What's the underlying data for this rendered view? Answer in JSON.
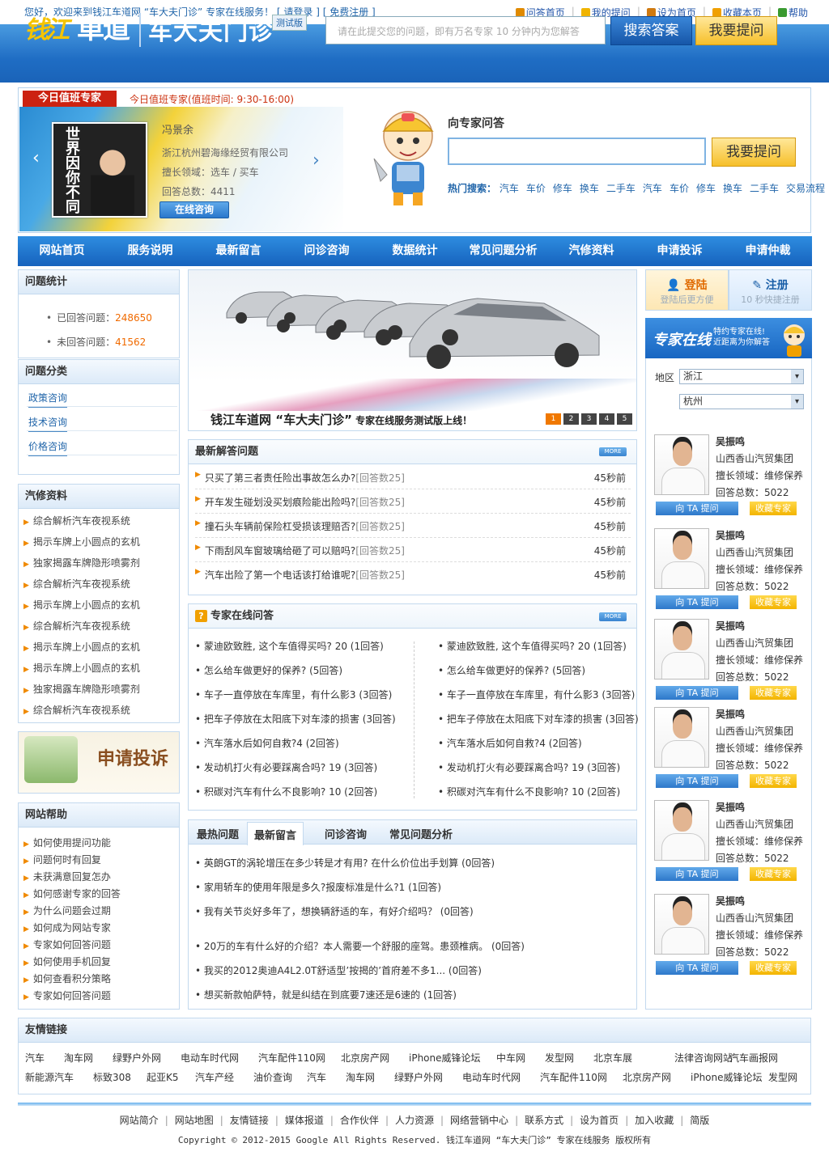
{
  "topbar": {
    "welcome": "您好，欢迎来到钱江车道网 “车大夫门诊” 专家在线服务！",
    "login": "[ 请登录 ]",
    "register": "[ 免费注册 ]",
    "links": [
      {
        "label": "问答首页",
        "icon": "home-icon",
        "color": "#e08a00"
      },
      {
        "label": "我的提问",
        "icon": "bulb-icon",
        "color": "#f0b400"
      },
      {
        "label": "设为首页",
        "icon": "pencil-icon",
        "color": "#d07a10"
      },
      {
        "label": "收藏本页",
        "icon": "star-icon",
        "color": "#f0a000"
      },
      {
        "label": "帮助",
        "icon": "help-icon",
        "color": "#3a9a30"
      }
    ]
  },
  "header": {
    "logo_qj": "钱江",
    "logo_cd": "車道",
    "title": "车大夫门诊",
    "badge": "测试版",
    "search_placeholder": "请在此提交您的问题，即有万名专家 10 分钟内为您解答",
    "search_button": "搜索答案",
    "ask_button": "我要提问"
  },
  "duty": {
    "badge": "今日值班专家",
    "title": "今日值班专家(值班时间: 9:30-16:00)",
    "book_text": "世界因你不同",
    "name": "冯景余",
    "company": "浙江杭州碧海缘经贸有限公司",
    "field": "擅长领域：选车 / 买车",
    "count": "回答总数：4411",
    "consult": "在线咨询"
  },
  "ask": {
    "title": "向专家问答",
    "button": "我要提问",
    "hot_label": "热门搜索：",
    "hot": [
      "汽车",
      "车价",
      "修车",
      "换车",
      "二手车",
      "汽车",
      "车价",
      "修车",
      "换车",
      "二手车",
      "交易流程"
    ]
  },
  "nav": [
    "网站首页",
    "服务说明",
    "最新留言",
    "问诊咨询",
    "数据统计",
    "常见问题分析",
    "汽修资料",
    "申请投诉",
    "申请仲裁"
  ],
  "stats": {
    "title": "问题统计",
    "answered_label": "已回答问题：",
    "answered": "248650",
    "unanswered_label": "未回答问题：",
    "unanswered": "41562"
  },
  "categories": {
    "title": "问题分类",
    "items": [
      "政策咨询",
      "技术咨询",
      "价格咨询"
    ]
  },
  "autos": {
    "title": "汽修资料",
    "items": [
      "综合解析汽车夜视系统",
      "揭示车牌上小圆点的玄机",
      "独家揭露车牌隐形喷雾剂",
      "综合解析汽车夜视系统",
      "揭示车牌上小圆点的玄机",
      "综合解析汽车夜视系统",
      "揭示车牌上小圆点的玄机",
      "揭示车牌上小圆点的玄机",
      "独家揭露车牌隐形喷雾剂",
      "综合解析汽车夜视系统"
    ]
  },
  "complain": {
    "label": "申请投诉"
  },
  "help": {
    "title": "网站帮助",
    "items": [
      "如何使用提问功能",
      "问题何时有回复",
      "未获满意回复怎办",
      "如何感谢专家的回答",
      "为什么问题会过期",
      "如何成为网站专家",
      "专家如何回答问题",
      "如何使用手机回复",
      "如何查看积分策略",
      "专家如何回答问题"
    ]
  },
  "banner": {
    "text": "钱江车道网 “车大夫门诊”",
    "sub": " 专家在线服务测试版上线！",
    "dots": [
      "1",
      "2",
      "3",
      "4",
      "5"
    ]
  },
  "latest": {
    "title": "最新解答问题",
    "more": "MORE",
    "items": [
      {
        "q": "只买了第三者责任险出事故怎么办?",
        "c": "[回答数25]",
        "t": "45秒前"
      },
      {
        "q": "开车发生碰划没买划痕险能出险吗?",
        "c": "[回答数25]",
        "t": "45秒前"
      },
      {
        "q": "撞石头车辆前保险杠受损该理赔否?",
        "c": "[回答数25]",
        "t": "45秒前"
      },
      {
        "q": "下雨刮风车窗玻璃给砸了可以赔吗?",
        "c": "[回答数25]",
        "t": "45秒前"
      },
      {
        "q": "汽车出险了第一个电话该打给谁呢?",
        "c": "[回答数25]",
        "t": "45秒前"
      }
    ]
  },
  "online": {
    "title": "专家在线问答",
    "more": "MORE",
    "left": [
      "蒙迪欧致胜, 这个车值得买吗? 20 (1回答)",
      "怎么给车做更好的保养? (5回答)",
      "车子一直停放在车库里，有什么影3 (3回答)",
      "把车子停放在太阳底下对车漆的损害 (3回答)",
      "汽车落水后如何自救?4 (2回答)",
      "发动机打火有必要踩离合吗? 19 (3回答)",
      "积碳对汽车有什么不良影响? 10 (2回答)"
    ],
    "right": [
      "蒙迪欧致胜, 这个车值得买吗? 20 (1回答)",
      "怎么给车做更好的保养? (5回答)",
      "车子一直停放在车库里，有什么影3 (3回答)",
      "把车子停放在太阳底下对车漆的损害 (3回答)",
      "汽车落水后如何自救?4 (2回答)",
      "发动机打火有必要踩离合吗? 19 (3回答)",
      "积碳对汽车有什么不良影响? 10 (2回答)"
    ]
  },
  "tabs": {
    "labels": [
      "最热问题",
      "最新留言",
      "问诊咨询",
      "常见问题分析"
    ],
    "items": [
      "英朗GT的涡轮增压在多少转是才有用? 在什么价位出手划算 (0回答)",
      "家用轿车的使用年限是多久?报废标准是什么?1 (1回答)",
      "我有关节炎好多年了，想换辆舒适的车，有好介绍吗？ (0回答)",
      "20万的车有什么好的介绍？本人需要一个舒服的座驾。患颈椎病。 (0回答)",
      "我买的2012奥迪A4L2.0T舒适型’按揭的’首府差不多1... (0回答)",
      "想买新款帕萨特，就是纠结在到底要7速还是6速的 (1回答)"
    ]
  },
  "login": {
    "login": "登陆",
    "login_sub": "登陆后更方便",
    "register": "注册",
    "register_sub": "10 秒快捷注册"
  },
  "expert_online": {
    "title": "专家在线",
    "sub1": "特约专家在线!",
    "sub2": "近距离为你解答",
    "region_label": "地区",
    "province": "浙江",
    "city": "杭州"
  },
  "experts": [
    {
      "name": "吴振鸣",
      "company": "山西香山汽贸集团",
      "field": "擅长领域：维修保养",
      "count": "回答总数：5022",
      "ask": "向 TA 提问",
      "fav": "收藏专家"
    },
    {
      "name": "吴振鸣",
      "company": "山西香山汽贸集团",
      "field": "擅长领域：维修保养",
      "count": "回答总数：5022",
      "ask": "向 TA 提问",
      "fav": "收藏专家"
    },
    {
      "name": "吴振鸣",
      "company": "山西香山汽贸集团",
      "field": "擅长领域：维修保养",
      "count": "回答总数：5022",
      "ask": "向 TA 提问",
      "fav": "收藏专家"
    },
    {
      "name": "吴振鸣",
      "company": "山西香山汽贸集团",
      "field": "擅长领域：维修保养",
      "count": "回答总数：5022",
      "ask": "向 TA 提问",
      "fav": "收藏专家"
    },
    {
      "name": "吴振鸣",
      "company": "山西香山汽贸集团",
      "field": "擅长领域：维修保养",
      "count": "回答总数：5022",
      "ask": "向 TA 提问",
      "fav": "收藏专家"
    },
    {
      "name": "吴振鸣",
      "company": "山西香山汽贸集团",
      "field": "擅长领域：维修保养",
      "count": "回答总数：5022",
      "ask": "向 TA 提问",
      "fav": "收藏专家"
    }
  ],
  "friends": {
    "title": "友情链接",
    "row1": [
      "汽车",
      "淘车网",
      "绿野户外网",
      "电动车时代网",
      "汽车配件110网",
      "北京房产网",
      "iPhone威锋论坛",
      "中车网",
      "发型网",
      "北京车展",
      "法律咨询网站",
      "汽车画报网"
    ],
    "row2": [
      "新能源汽车",
      "标致308",
      "起亚K5",
      "汽车产经",
      "油价查询",
      "汽车",
      "淘车网",
      "绿野户外网",
      "电动车时代网",
      "汽车配件110网",
      "北京房产网",
      "iPhone威锋论坛",
      "发型网"
    ]
  },
  "footer": {
    "links": [
      "网站简介",
      "网站地图",
      "友情链接",
      "媒体报道",
      "合作伙伴",
      "人力资源",
      "网络营销中心",
      "联系方式",
      "设为首页",
      "加入收藏",
      "简版"
    ],
    "copyright": "Copyright © 2012-2015 Google All Rights Reserved. 钱江车道网 “车大夫门诊” 专家在线服务 版权所有"
  }
}
